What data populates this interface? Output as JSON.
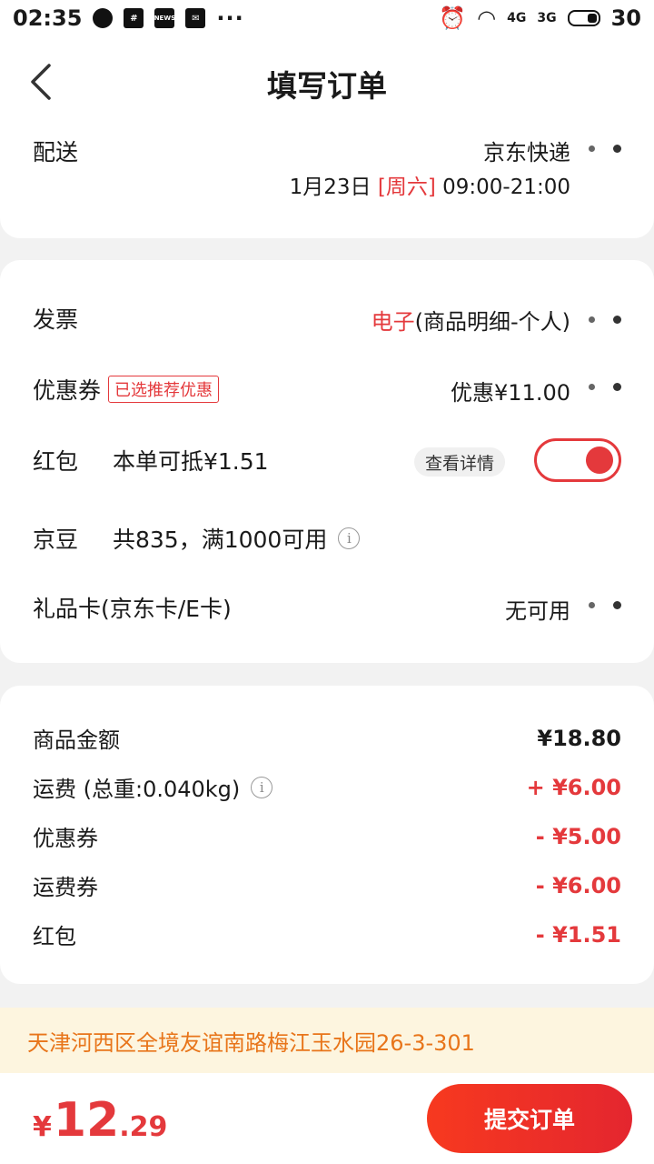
{
  "status_bar": {
    "time": "02:35",
    "battery": "30",
    "net1": "4G",
    "net2": "3G",
    "more": "···",
    "news_icon_label": "NEWS"
  },
  "header": {
    "title": "填写订单"
  },
  "delivery": {
    "label": "配送",
    "carrier": "京东快递",
    "date": "1月23日",
    "weekday": "[周六]",
    "time_range": "09:00-21:00"
  },
  "invoice": {
    "label": "发票",
    "type": "电子",
    "detail": "(商品明细-个人)"
  },
  "coupon": {
    "label": "优惠券",
    "tag": "已选推荐优惠",
    "value": "优惠¥11.00"
  },
  "red_packet": {
    "label": "红包",
    "desc": "本单可抵¥1.51",
    "detail_btn": "查看详情",
    "enabled": true
  },
  "jingdou": {
    "label": "京豆",
    "desc": "共835，满1000可用"
  },
  "gift_card": {
    "label": "礼品卡(京东卡/E卡)",
    "value": "无可用"
  },
  "summary": {
    "items": [
      {
        "label": "商品金额",
        "value": "¥18.80"
      },
      {
        "label": "运费 (总重:0.040kg)",
        "value": "+ ¥6.00"
      },
      {
        "label": "优惠券",
        "value": "- ¥5.00"
      },
      {
        "label": "运费券",
        "value": "- ¥6.00"
      },
      {
        "label": "红包",
        "value": "- ¥1.51"
      }
    ]
  },
  "address": {
    "text": "天津河西区全境友谊南路梅江玉水园26-3-301"
  },
  "footer": {
    "currency": "¥",
    "price_int": "12",
    "price_dec": ".29",
    "submit": "提交订单"
  },
  "colors": {
    "accent": "#e4393c",
    "address_bg": "#fdf5df",
    "address_text": "#e8751a"
  }
}
